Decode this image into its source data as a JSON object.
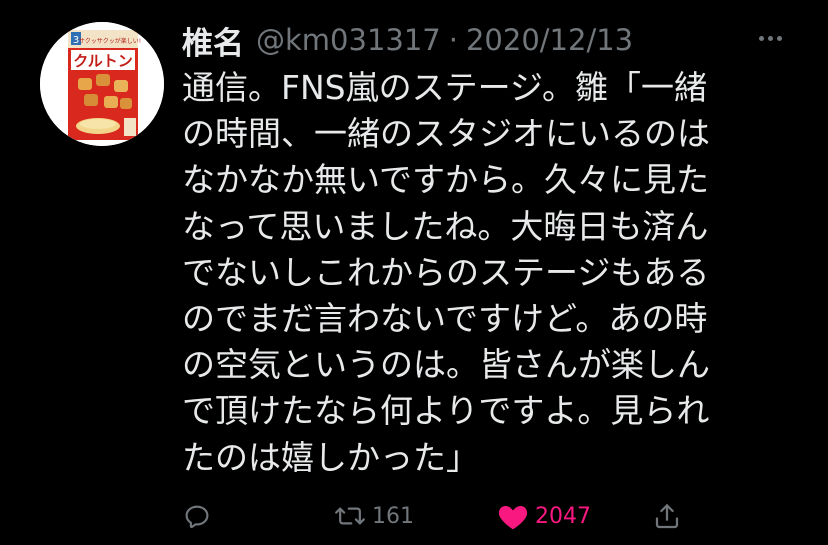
{
  "tweet": {
    "display_name": "椎名",
    "handle": "@km031317",
    "separator": "·",
    "date": "2020/12/13",
    "body_lines": [
      "通信。FNS嵐のステージ。雛「一緒",
      "の時間、一緒のスタジオにいるのは",
      "なかなか無いですから。久々に見た",
      "なって思いましたね。大晦日も済ん",
      "でないしこれからのステージもある",
      "のでまだ言わないですけど。あの時",
      "の空気というのは。皆さんが楽しん",
      "で頂けたなら何よりですよ。見られ",
      "たのは嬉しかった」"
    ]
  },
  "avatar": {
    "product_text": "クルトン",
    "badge": "3",
    "tagline": "サクッサクッが楽しい!"
  },
  "actions": {
    "reply": {
      "icon": "reply-icon",
      "count": ""
    },
    "retweet": {
      "icon": "retweet-icon",
      "count": "161"
    },
    "like": {
      "icon": "heart-icon",
      "count": "2047",
      "color": "#f91880",
      "liked": true
    },
    "share": {
      "icon": "share-icon",
      "count": ""
    }
  },
  "colors": {
    "background": "#000000",
    "text": "#e7e9ea",
    "secondary": "#71767b",
    "like": "#f91880"
  }
}
